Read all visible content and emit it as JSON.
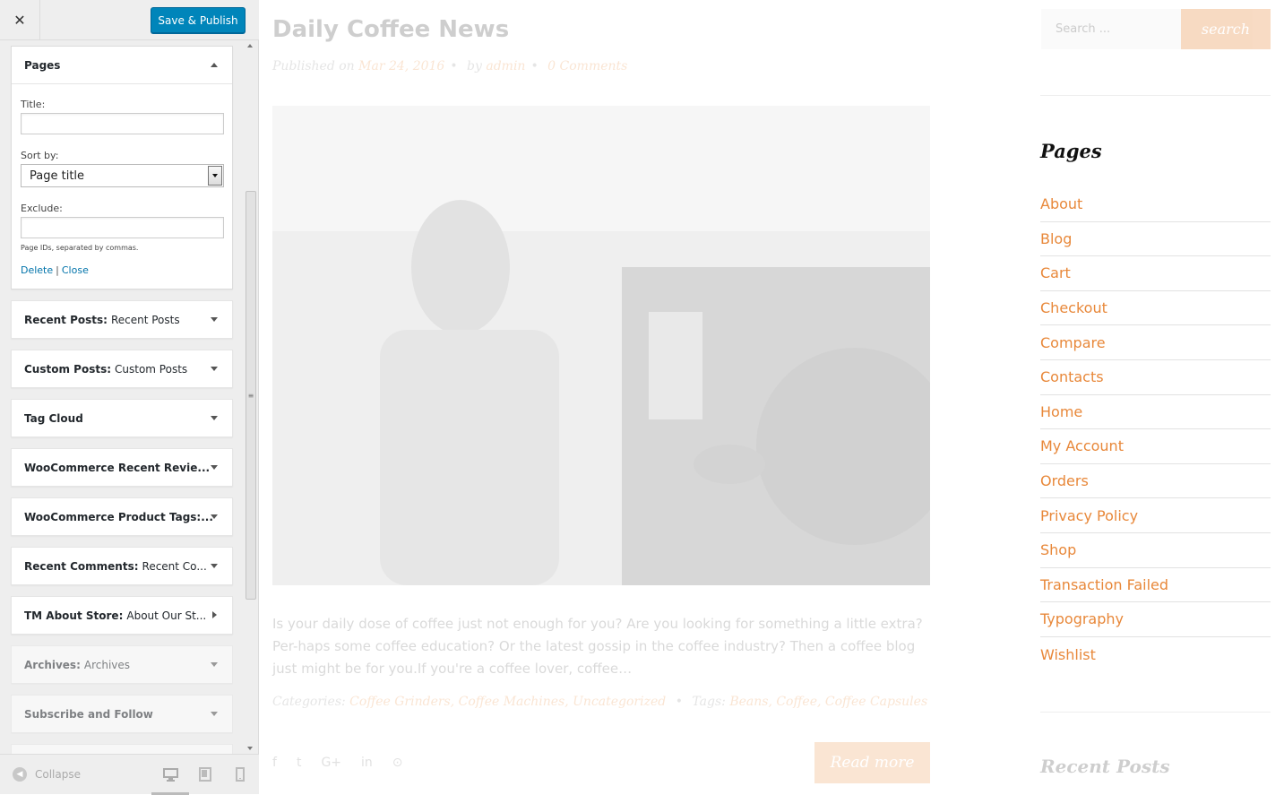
{
  "header": {
    "close_glyph": "✕",
    "save_label": "Save & Publish"
  },
  "pages_widget": {
    "title": "Pages",
    "title_label": "Title:",
    "title_value": "",
    "sort_label": "Sort by:",
    "sort_value": "Page title",
    "exclude_label": "Exclude:",
    "exclude_value": "",
    "help_text": "Page IDs, separated by commas.",
    "delete_label": "Delete",
    "separator": "|",
    "close_label": "Close"
  },
  "widgets": [
    {
      "name": "Recent Posts:",
      "sub": "Recent Posts"
    },
    {
      "name": "Custom Posts:",
      "sub": "Custom Posts"
    },
    {
      "name": "Tag Cloud",
      "sub": ""
    },
    {
      "name": "WooCommerce Recent Revie...",
      "sub": ""
    },
    {
      "name": "WooCommerce Product Tags:...",
      "sub": ""
    },
    {
      "name": "Recent Comments:",
      "sub": "Recent Co..."
    },
    {
      "name": "TM About Store:",
      "sub": "About Our St..."
    },
    {
      "name": "Archives:",
      "sub": "Archives"
    },
    {
      "name": "Subscribe and Follow",
      "sub": ""
    }
  ],
  "footer": {
    "collapse_label": "Collapse"
  },
  "post": {
    "title": "Daily Coffee News",
    "published_prefix": "Published on",
    "date": "Mar 24, 2016",
    "by_prefix": "by",
    "author": "admin",
    "comments": "0 Comments",
    "excerpt": "Is your daily dose of coffee just not enough for you? Are you looking for something a little extra? Per-haps some coffee education? Or the latest gossip in the coffee industry? Then a coffee blog just might be for you.If you're a coffee lover, coffee…",
    "categories_prefix": "Categories:",
    "categories": "Coffee Grinders, Coffee Machines, Uncategorized",
    "tags_prefix": "Tags:",
    "tags": "Beans, Coffee, Coffee Capsules",
    "read_more": "Read more"
  },
  "sidebar": {
    "search_placeholder": "Search ...",
    "search_button": "search",
    "pages_heading": "Pages",
    "pages": [
      "About",
      "Blog",
      "Cart",
      "Checkout",
      "Compare",
      "Contacts",
      "Home",
      "My Account",
      "Orders",
      "Privacy Policy",
      "Shop",
      "Transaction Failed",
      "Typography",
      "Wishlist"
    ],
    "recent_heading": "Recent Posts"
  },
  "colors": {
    "accent": "#e8883a",
    "wp_blue": "#0085ba",
    "link_blue": "#0073aa"
  }
}
